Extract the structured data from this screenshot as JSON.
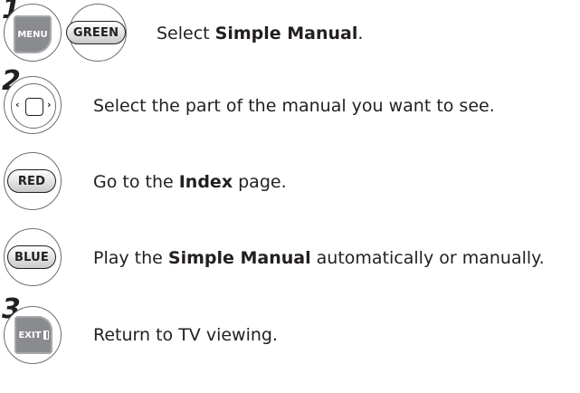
{
  "steps": {
    "step1": {
      "number": "1",
      "keys": {
        "menu": "MENU",
        "green": "GREEN"
      },
      "text": {
        "pre": "Select ",
        "bold": "Simple Manual",
        "post": "."
      }
    },
    "step2": {
      "number": "2",
      "nav_key_icon": "navigation-pad-icon",
      "text": "Select the part of the manual you want to see.",
      "red": {
        "key": "RED",
        "text": {
          "pre": "Go to the ",
          "bold": "Index",
          "post": " page."
        }
      },
      "blue": {
        "key": "BLUE",
        "text": {
          "pre": "Play the ",
          "bold": "Simple Manual",
          "post": " automatically or manually."
        }
      }
    },
    "step3": {
      "number": "3",
      "key": "EXIT",
      "text": "Return to TV viewing."
    }
  },
  "colors": {
    "text": "#231f20",
    "key_gray": "#8a8b8e",
    "circle_border": "#6d6e71"
  }
}
